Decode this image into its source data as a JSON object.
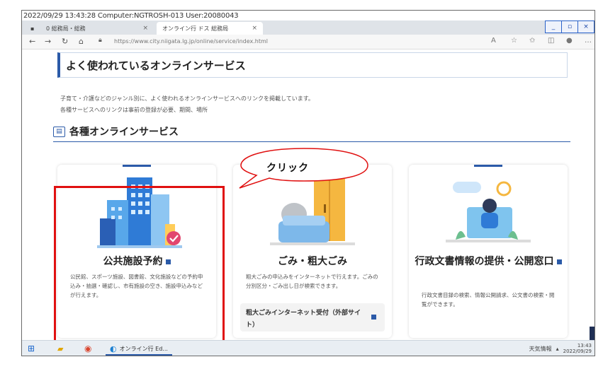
{
  "stamp": "2022/09/29 13:43:28 Computer:NGTROSH-013 User:20080043",
  "browser": {
    "tab1_label": "0 総務局・総務",
    "tab2_label": "オンライン行 ドス 総務局",
    "url": "https://www.city.niigata.lg.jp/online/service/index.html",
    "win_min": "_",
    "win_max": "▫",
    "win_close": "×"
  },
  "page": {
    "section_title": "よく使われているオンラインサービス",
    "desc_line1": "子育て・介護などのジャンル別に、よく使われるオンラインサービスへのリンクを掲載しています。",
    "desc_line2": "各種サービスへのリンクは事前の登録が必要、期間、場所",
    "subheading": "各種オンラインサービス",
    "callout_label": "クリック"
  },
  "cards": [
    {
      "title": "公共施設予約",
      "text": "公民館、スポーツ施設、図書館、文化施設などの予約申込み・抽選・確認し、市有施設の空き、施設申込みなどが行えます。"
    },
    {
      "title": "ごみ・粗大ごみ",
      "text": "粗大ごみの申込みをインターネットで行えます。ごみの分別区分・ごみ出し日が検索できます。",
      "link_label": "粗大ごみインターネット受付（外部サイト）"
    },
    {
      "title": "行政文書情報の提供・公開窓口",
      "text": "行政文書目録の検索、情報公開請求、公文書の検索・閲覧ができます。"
    }
  ],
  "taskbar": {
    "app_label": "オンライン行 Ed...",
    "tray_text": "天気情報",
    "time": "13:43",
    "date": "2022/09/29"
  },
  "colors": {
    "accent": "#2b5aa8",
    "highlight": "#e01010"
  }
}
